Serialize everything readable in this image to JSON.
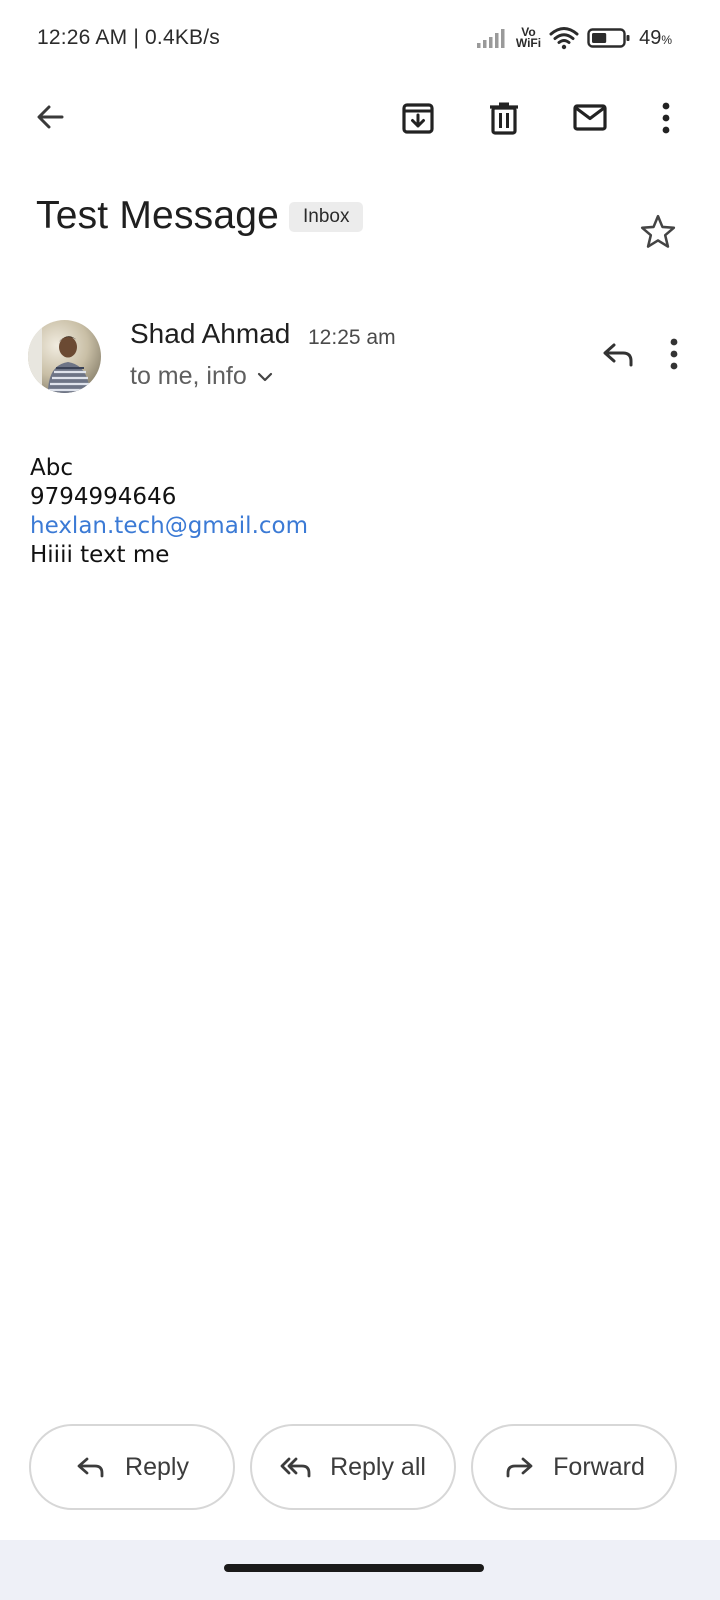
{
  "status_bar": {
    "time_speed": "12:26 AM | 0.4KB/s",
    "vowifi_top": "Vo",
    "vowifi_bottom": "WiFi",
    "battery_value": "49",
    "battery_unit": "%",
    "battery_level": 0.49
  },
  "top_bar": {
    "icons": [
      "back-arrow-icon",
      "archive-icon",
      "delete-icon",
      "mark-unread-icon",
      "more-vert-icon"
    ]
  },
  "email": {
    "subject": "Test Message",
    "label": "Inbox",
    "sender_name": "Shad Ahmad",
    "time": "12:25 am",
    "recipients": "to me, info",
    "body": {
      "line1": "Abc",
      "line2": "9794994646",
      "email_link": "hexlan.tech@gmail.com",
      "line4": "Hiiii text me"
    }
  },
  "actions": {
    "reply": "Reply",
    "reply_all": "Reply all",
    "forward": "Forward"
  },
  "colors": {
    "link": "#3b7ad5",
    "chip_bg": "#ececec",
    "nav_bg": "#eef0f7"
  }
}
